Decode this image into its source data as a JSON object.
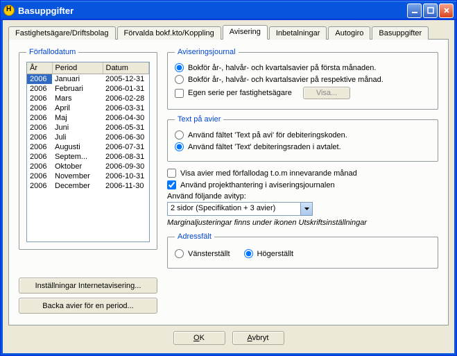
{
  "window": {
    "title": "Basuppgifter"
  },
  "tabs": [
    "Fastighetsägare/Driftsbolag",
    "Förvalda bokf.kto/Koppling",
    "Avisering",
    "Inbetalningar",
    "Autogiro",
    "Basuppgifter"
  ],
  "active_tab": 2,
  "forfallo": {
    "legend": "Förfallodatum",
    "cols": [
      "År",
      "Period",
      "Datum"
    ],
    "rows": [
      {
        "ar": "2006",
        "period": "Januari",
        "datum": "2005-12-31",
        "selected": true
      },
      {
        "ar": "2006",
        "period": "Februari",
        "datum": "2006-01-31"
      },
      {
        "ar": "2006",
        "period": "Mars",
        "datum": "2006-02-28"
      },
      {
        "ar": "2006",
        "period": "April",
        "datum": "2006-03-31"
      },
      {
        "ar": "2006",
        "period": "Maj",
        "datum": "2006-04-30"
      },
      {
        "ar": "2006",
        "period": "Juni",
        "datum": "2006-05-31"
      },
      {
        "ar": "2006",
        "period": "Juli",
        "datum": "2006-06-30"
      },
      {
        "ar": "2006",
        "period": "Augusti",
        "datum": "2006-07-31"
      },
      {
        "ar": "2006",
        "period": "Septem...",
        "datum": "2006-08-31"
      },
      {
        "ar": "2006",
        "period": "Oktober",
        "datum": "2006-09-30"
      },
      {
        "ar": "2006",
        "period": "November",
        "datum": "2006-10-31"
      },
      {
        "ar": "2006",
        "period": "December",
        "datum": "2006-11-30"
      }
    ]
  },
  "buttons": {
    "internet": "Inställningar Internetavisering...",
    "backa": "Backa avier för en period...",
    "visa": "Visa...",
    "ok": "OK",
    "cancel": "Avbryt"
  },
  "aviseringsjournal": {
    "legend": "Aviseringsjournal",
    "opt1": "Bokför år-, halvår- och kvartalsavier på första månaden.",
    "opt2": "Bokför år-, halvår- och kvartalsavier på respektive månad.",
    "egen": "Egen serie per fastighetsägare"
  },
  "textpaavier": {
    "legend": "Text på avier",
    "opt1": "Använd fältet 'Text på avi' för debiteringskoden.",
    "opt2": "Använd fältet 'Text' debiteringsraden i avtalet."
  },
  "checks": {
    "visa": "Visa avier med förfallodag t.o.m innevarande månad",
    "projekt": "Använd projekthantering i aviseringsjournalen"
  },
  "avityp": {
    "label": "Använd följande avityp:",
    "value": "2 sidor (Specifikation +  3 avier)",
    "note": "Marginaljusteringar finns under ikonen Utskriftsinställningar"
  },
  "adress": {
    "legend": "Adressfält",
    "left": "Vänsterställt",
    "right": "Högerställt"
  }
}
